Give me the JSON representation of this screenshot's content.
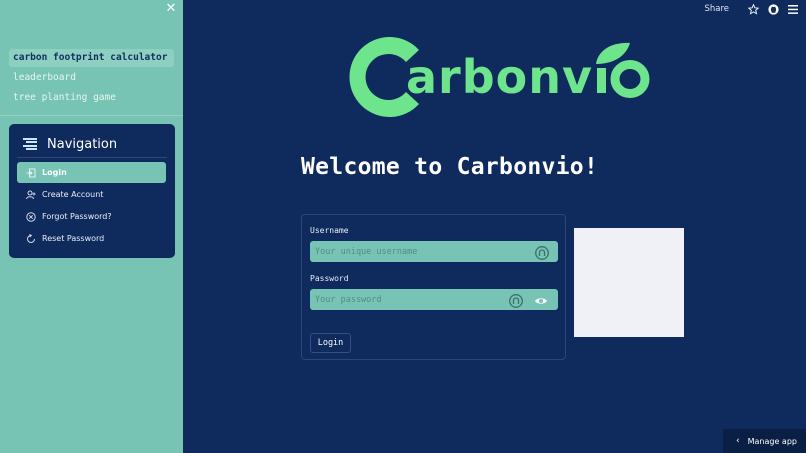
{
  "sidebar": {
    "pages": [
      {
        "label": "carbon footprint calculator"
      },
      {
        "label": "leaderboard"
      },
      {
        "label": "tree planting game"
      }
    ],
    "nav": {
      "title": "Navigation",
      "items": [
        {
          "label": "Login",
          "icon": "login-icon"
        },
        {
          "label": "Create Account",
          "icon": "person-add-icon"
        },
        {
          "label": "Forgot Password?",
          "icon": "x-circle-icon"
        },
        {
          "label": "Reset Password",
          "icon": "reset-icon"
        }
      ]
    }
  },
  "header": {
    "share_label": "Share"
  },
  "logo": {
    "text": "Carbonvio",
    "color": "#6ee58c"
  },
  "main": {
    "welcome": "Welcome to Carbonvio!",
    "form": {
      "username_label": "Username",
      "username_placeholder": "Your unique username",
      "password_label": "Password",
      "password_placeholder": "Your password",
      "login_button": "Login"
    }
  },
  "manage_app": {
    "label": "Manage app"
  },
  "colors": {
    "background": "#0f2a5c",
    "sidebar": "#77c4b4",
    "accent": "#6ee58c"
  }
}
